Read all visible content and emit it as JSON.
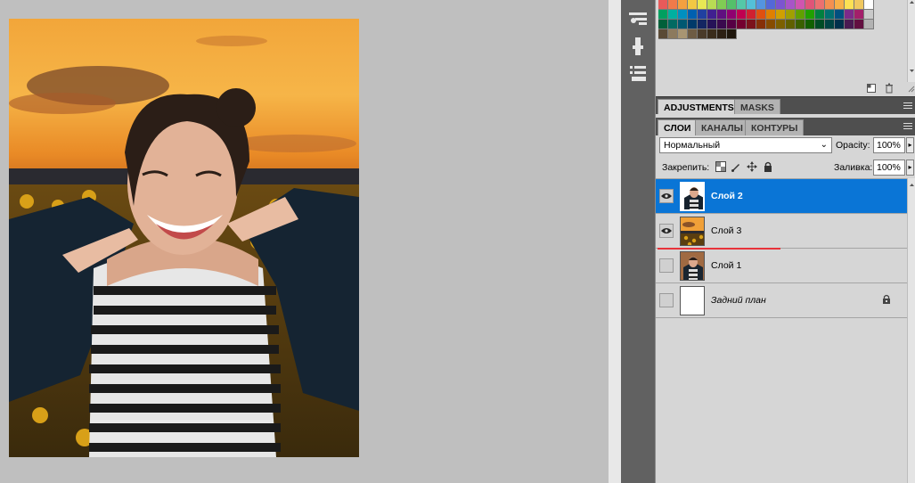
{
  "colors": {
    "accent_selection": "#0a75d6",
    "panel_bg": "#d6d6d6",
    "tab_bar_bg": "#4f4f4f",
    "canvas_bg": "#bfbfbf",
    "dock_bg": "#616161",
    "annotation_red": "#e8323a"
  },
  "dock": {
    "icons": [
      "tool-presets-icon",
      "brush-presets-icon",
      "clone-source-icon"
    ]
  },
  "swatches": {
    "rows": [
      [
        "#e85a5a",
        "#f07a4a",
        "#f4a040",
        "#f2c844",
        "#e8e854",
        "#b8dc54",
        "#80cc54",
        "#54c06a",
        "#54c8a8",
        "#54c0d8",
        "#5494e0",
        "#5468d8",
        "#7c54d0",
        "#a854c8",
        "#d054b0",
        "#e05478",
        "#ec7070",
        "#f49050",
        "#f8b048",
        "#fce054",
        "#f0c860",
        "#ffffff"
      ],
      [
        "#00a060",
        "#00b0a0",
        "#0090c0",
        "#0060b0",
        "#2040a0",
        "#402090",
        "#601080",
        "#900070",
        "#c00050",
        "#d02030",
        "#e05010",
        "#e08000",
        "#d0a000",
        "#a0a000",
        "#60a000",
        "#20a000",
        "#008040",
        "#007070",
        "#005080",
        "#7d2a8a",
        "#a31f6a",
        "#c9c9c9"
      ],
      [
        "#00603a",
        "#006a62",
        "#005872",
        "#003a6a",
        "#132662",
        "#261358",
        "#3a0a4e",
        "#560044",
        "#740030",
        "#7c121c",
        "#863008",
        "#864c00",
        "#7c6000",
        "#606000",
        "#3a6000",
        "#126000",
        "#004c26",
        "#004444",
        "#00304c",
        "#4a1a52",
        "#620f40",
        "#b2b2b2"
      ],
      [
        "#5a4a36",
        "#8c7a5e",
        "#a89572",
        "#6e5c44",
        "#4a3b2a",
        "#3a2c1c",
        "#2c2014",
        "#1e160c"
      ]
    ]
  },
  "adjustments_panel": {
    "tabs": [
      {
        "label": "ADJUSTMENTS",
        "active": true
      },
      {
        "label": "MASKS",
        "active": false
      }
    ]
  },
  "layers_panel": {
    "tabs": [
      {
        "label": "СЛОИ",
        "active": true
      },
      {
        "label": "КАНАЛЫ",
        "active": false
      },
      {
        "label": "КОНТУРЫ",
        "active": false
      }
    ],
    "blend_mode": "Нормальный",
    "opacity_label": "Opacity:",
    "opacity_value": "100%",
    "lock_label": "Закрепить:",
    "fill_label": "Заливка:",
    "fill_value": "100%",
    "layers": [
      {
        "name": "Слой 2",
        "visible": true,
        "selected": true,
        "thumb": "portrait",
        "locked": false
      },
      {
        "name": "Слой 3",
        "visible": true,
        "selected": false,
        "thumb": "sunset",
        "locked": false
      },
      {
        "name": "Слой 1",
        "visible": false,
        "selected": false,
        "thumb": "photo",
        "locked": false
      },
      {
        "name": "Задний план",
        "visible": false,
        "selected": false,
        "thumb": "white",
        "locked": true
      }
    ]
  }
}
